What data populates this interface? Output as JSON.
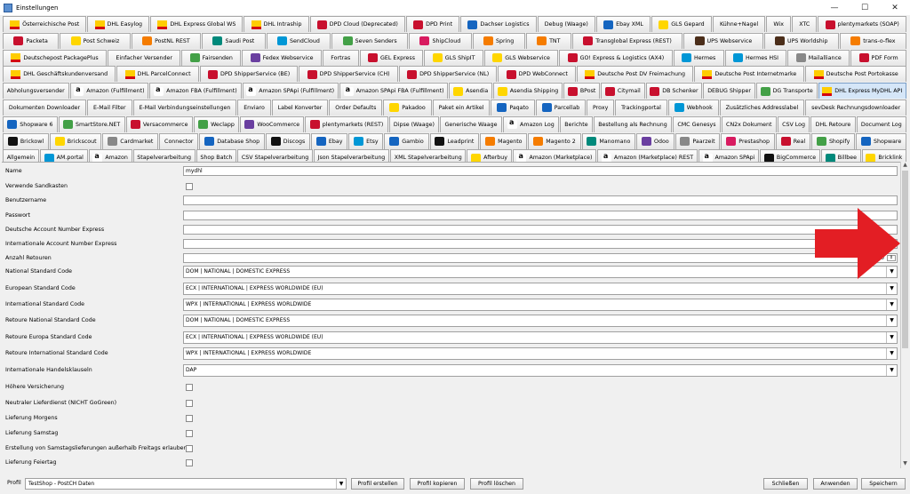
{
  "window": {
    "title": "Einstellungen",
    "controls": [
      "—",
      "☐",
      "✕"
    ]
  },
  "tab_rows": [
    [
      {
        "label": "Österreichische Post",
        "icon": "dhl"
      },
      {
        "label": "DHL Easylog",
        "icon": "dhl"
      },
      {
        "label": "DHL Express Global WS",
        "icon": "dhl"
      },
      {
        "label": "DHL Intraship",
        "icon": "dhl"
      },
      {
        "label": "DPD Cloud (Deprecated)",
        "icon": "red"
      },
      {
        "label": "DPD Print",
        "icon": "red"
      },
      {
        "label": "Dachser Logistics",
        "icon": "blue"
      },
      {
        "label": "Debug (Waage)",
        "icon": ""
      },
      {
        "label": "Ebay XML",
        "icon": "blue"
      },
      {
        "label": "GLS Gepard",
        "icon": "yellow"
      },
      {
        "label": "Kühne+Nagel",
        "icon": ""
      },
      {
        "label": "Wix",
        "icon": ""
      },
      {
        "label": "XTC",
        "icon": ""
      },
      {
        "label": "plentymarkets (SOAP)",
        "icon": "red"
      }
    ],
    [
      {
        "label": "Packeta",
        "icon": "red"
      },
      {
        "label": "Post Schweiz",
        "icon": "yellow"
      },
      {
        "label": "PostNL REST",
        "icon": "orange"
      },
      {
        "label": "Saudi Post",
        "icon": "teal"
      },
      {
        "label": "SendCloud",
        "icon": "cyan"
      },
      {
        "label": "Seven Senders",
        "icon": "green"
      },
      {
        "label": "ShipCloud",
        "icon": "pink"
      },
      {
        "label": "Spring",
        "icon": "orange"
      },
      {
        "label": "TNT",
        "icon": "orange"
      },
      {
        "label": "Transglobal Express (REST)",
        "icon": "red"
      },
      {
        "label": "UPS Webservice",
        "icon": "ups"
      },
      {
        "label": "UPS Worldship",
        "icon": "ups"
      },
      {
        "label": "trans-o-flex",
        "icon": "orange"
      }
    ],
    [
      {
        "label": "Deutschepost PackagePlus",
        "icon": "dhl"
      },
      {
        "label": "Einfacher Versender",
        "icon": ""
      },
      {
        "label": "Fairsenden",
        "icon": "green"
      },
      {
        "label": "Fedex Webservice",
        "icon": "purple"
      },
      {
        "label": "Fortras",
        "icon": ""
      },
      {
        "label": "GEL Express",
        "icon": "red"
      },
      {
        "label": "GLS ShipIT",
        "icon": "yellow"
      },
      {
        "label": "GLS Webservice",
        "icon": "yellow"
      },
      {
        "label": "GO! Express & Logistics (AX4)",
        "icon": "red"
      },
      {
        "label": "Hermes",
        "icon": "cyan"
      },
      {
        "label": "Hermes HSI",
        "icon": "cyan"
      },
      {
        "label": "Mailalliance",
        "icon": "grey"
      },
      {
        "label": "PDF Form",
        "icon": "red"
      }
    ],
    [
      {
        "label": "DHL Geschäftskundenversand",
        "icon": "dhl"
      },
      {
        "label": "DHL ParcelConnect",
        "icon": "dhl"
      },
      {
        "label": "DPD ShipperService (BE)",
        "icon": "red"
      },
      {
        "label": "DPD ShipperService (CH)",
        "icon": "red"
      },
      {
        "label": "DPD ShipperService (NL)",
        "icon": "red"
      },
      {
        "label": "DPD WebConnect",
        "icon": "red"
      },
      {
        "label": "Deutsche Post DV Freimachung",
        "icon": "dhl"
      },
      {
        "label": "Deutsche Post Internetmarke",
        "icon": "dhl"
      },
      {
        "label": "Deutsche Post Portokasse",
        "icon": "dhl"
      }
    ],
    [
      {
        "label": "Abholungsversender",
        "icon": ""
      },
      {
        "label": "Amazon (Fulfillment)",
        "icon": "amazon"
      },
      {
        "label": "Amazon FBA (Fulfillment)",
        "icon": "amazon"
      },
      {
        "label": "Amazon SPApi (Fulfillment)",
        "icon": "amazon"
      },
      {
        "label": "Amazon SPApi FBA (Fulfillment)",
        "icon": "amazon"
      },
      {
        "label": "Asendia",
        "icon": "yellow"
      },
      {
        "label": "Asendia Shipping",
        "icon": "yellow"
      },
      {
        "label": "BPost",
        "icon": "red"
      },
      {
        "label": "Citymail",
        "icon": "red"
      },
      {
        "label": "DB Schenker",
        "icon": "red"
      },
      {
        "label": "DEBUG Shipper",
        "icon": ""
      },
      {
        "label": "DG Transporte",
        "icon": "green"
      },
      {
        "label": "DHL Express MyDHL API",
        "icon": "dhl",
        "active": true
      }
    ],
    [
      {
        "label": "Dokumenten Downloader",
        "icon": ""
      },
      {
        "label": "E-Mail Filter",
        "icon": ""
      },
      {
        "label": "E-Mail Verbindungseinstellungen",
        "icon": ""
      },
      {
        "label": "Enviaro",
        "icon": ""
      },
      {
        "label": "Label Konverter",
        "icon": ""
      },
      {
        "label": "Order Defaults",
        "icon": ""
      },
      {
        "label": "Pakadoo",
        "icon": "yellow"
      },
      {
        "label": "Paket ein Artikel",
        "icon": ""
      },
      {
        "label": "Paqato",
        "icon": "blue"
      },
      {
        "label": "Parcellab",
        "icon": "blue"
      },
      {
        "label": "Proxy",
        "icon": ""
      },
      {
        "label": "Trackingportal",
        "icon": ""
      },
      {
        "label": "Webhook",
        "icon": "cyan"
      },
      {
        "label": "Zusätzliches Addresslabel",
        "icon": ""
      },
      {
        "label": "sevDesk Rechnungsdownloader",
        "icon": ""
      }
    ],
    [
      {
        "label": "Shopware 6",
        "icon": "blue"
      },
      {
        "label": "SmartStore.NET",
        "icon": "green"
      },
      {
        "label": "Versacommerce",
        "icon": "red"
      },
      {
        "label": "Weclapp",
        "icon": "green"
      },
      {
        "label": "WooCommerce",
        "icon": "purple"
      },
      {
        "label": "plentymarkets (REST)",
        "icon": "red"
      },
      {
        "label": "Dipse (Waage)",
        "icon": ""
      },
      {
        "label": "Generische Waage",
        "icon": ""
      },
      {
        "label": "Amazon Log",
        "icon": "amazon"
      },
      {
        "label": "Berichte",
        "icon": ""
      },
      {
        "label": "Bestellung als Rechnung",
        "icon": ""
      },
      {
        "label": "CMC Genesys",
        "icon": ""
      },
      {
        "label": "CN2x Dokument",
        "icon": ""
      },
      {
        "label": "CSV Log",
        "icon": ""
      },
      {
        "label": "DHL Retoure",
        "icon": ""
      },
      {
        "label": "Document Log",
        "icon": ""
      }
    ],
    [
      {
        "label": "Brickowl",
        "icon": "black"
      },
      {
        "label": "Brickscout",
        "icon": "yellow"
      },
      {
        "label": "Cardmarket",
        "icon": "grey"
      },
      {
        "label": "Connector",
        "icon": ""
      },
      {
        "label": "Database Shop",
        "icon": "blue"
      },
      {
        "label": "Discogs",
        "icon": "black"
      },
      {
        "label": "Ebay",
        "icon": "blue"
      },
      {
        "label": "Etsy",
        "icon": "cyan"
      },
      {
        "label": "Gambio",
        "icon": "blue"
      },
      {
        "label": "Leadprint",
        "icon": "black"
      },
      {
        "label": "Magento",
        "icon": "orange"
      },
      {
        "label": "Magento 2",
        "icon": "orange"
      },
      {
        "label": "Manomano",
        "icon": "teal"
      },
      {
        "label": "Odoo",
        "icon": "purple"
      },
      {
        "label": "Paarzeit",
        "icon": "grey"
      },
      {
        "label": "Prestashop",
        "icon": "pink"
      },
      {
        "label": "Real",
        "icon": "red"
      },
      {
        "label": "Shopify",
        "icon": "green"
      },
      {
        "label": "Shopware",
        "icon": "blue"
      }
    ],
    [
      {
        "label": "Allgemein",
        "icon": ""
      },
      {
        "label": "AM.portal",
        "icon": "cyan"
      },
      {
        "label": "Amazon",
        "icon": "amazon"
      },
      {
        "label": "Stapelverarbeitung",
        "icon": ""
      },
      {
        "label": "Shop Batch",
        "icon": ""
      },
      {
        "label": "CSV Stapelverarbeitung",
        "icon": ""
      },
      {
        "label": "Json Stapelverarbeitung",
        "icon": ""
      },
      {
        "label": "XML Stapelverarbeitung",
        "icon": ""
      },
      {
        "label": "Afterbuy",
        "icon": "yellow"
      },
      {
        "label": "Amazon (Marketplace)",
        "icon": "amazon"
      },
      {
        "label": "Amazon (Marketplace) REST",
        "icon": "amazon"
      },
      {
        "label": "Amazon SPApi",
        "icon": "amazon"
      },
      {
        "label": "BigCommerce",
        "icon": "black"
      },
      {
        "label": "Billbee",
        "icon": "teal"
      },
      {
        "label": "Bricklink",
        "icon": "yellow"
      }
    ]
  ],
  "fields": [
    {
      "label": "Name",
      "type": "text",
      "value": "mydhl"
    },
    {
      "label": "Verwende Sandkasten",
      "type": "check"
    },
    {
      "label": "Benutzername",
      "type": "text",
      "value": ""
    },
    {
      "label": "Passwort",
      "type": "text",
      "value": ""
    },
    {
      "label": "Deutsche Account Number Express",
      "type": "text",
      "value": ""
    },
    {
      "label": "Internationale Account Number Express",
      "type": "text",
      "value": ""
    },
    {
      "label": "Anzahl Retouren",
      "type": "spinner",
      "value": "0"
    },
    {
      "label": "National Standard Code",
      "type": "combo",
      "value": "DOM | NATIONAL | DOMESTIC EXPRESS"
    },
    {
      "label": "European Standard Code",
      "type": "combo",
      "value": "ECX | INTERNATIONAL | EXPRESS WORLDWIDE (EU)"
    },
    {
      "label": "International Standard Code",
      "type": "combo",
      "value": "WPX | INTERNATIONAL | EXPRESS WORLDWIDE"
    },
    {
      "label": "Retoure National Standard Code",
      "type": "combo",
      "value": "DOM | NATIONAL | DOMESTIC EXPRESS"
    },
    {
      "label": "Retoure Europa Standard Code",
      "type": "combo",
      "value": "ECX | INTERNATIONAL | EXPRESS WORLDWIDE (EU)"
    },
    {
      "label": "Retoure International Standard Code",
      "type": "combo",
      "value": "WPX | INTERNATIONAL | EXPRESS WORLDWIDE"
    },
    {
      "label": "Internationale Handelsklauseln",
      "type": "combo",
      "value": "DAP"
    },
    {
      "label": "Höhere Versicherung",
      "type": "check"
    },
    {
      "label": "Neutraler Lieferdienst (NICHT GoGreen)",
      "type": "check"
    },
    {
      "label": "Lieferung Morgens",
      "type": "check"
    },
    {
      "label": "Lieferung Samstag",
      "type": "check"
    },
    {
      "label": "Erstellung von Samstagslieferungen außerhalb Freitags erlauben",
      "type": "check"
    },
    {
      "label": "Lieferung Feiertag",
      "type": "check"
    }
  ],
  "bottom": {
    "profile_label": "Profil",
    "profile_value": "TestShop - PostCH Daten",
    "buttons": {
      "create": "Profil erstellen",
      "copy": "Profil kopieren",
      "delete": "Profil löschen",
      "close": "Schließen",
      "apply": "Anwenden",
      "save": "Speichern"
    }
  },
  "colors": {
    "annotation_arrow": "#e31e24",
    "active_tab": "#d5e6f8"
  }
}
